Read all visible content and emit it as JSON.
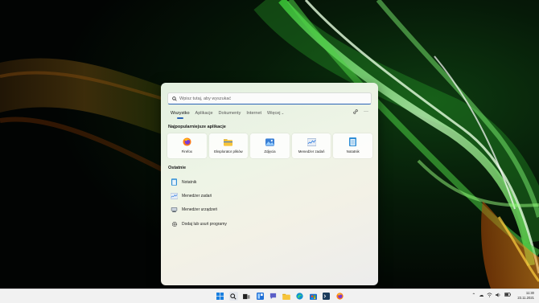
{
  "search": {
    "placeholder": "Wpisz tutaj, aby wyszukać",
    "value": ""
  },
  "tabs": [
    {
      "label": "Wszystko",
      "active": true
    },
    {
      "label": "Aplikacje"
    },
    {
      "label": "Dokumenty"
    },
    {
      "label": "Internet"
    },
    {
      "label": "Więcej",
      "has_dropdown": true
    }
  ],
  "tab_tools": {
    "share_icon": "share-icon",
    "more": "···"
  },
  "top_apps": {
    "title": "Najpopularniejsze aplikacje",
    "items": [
      {
        "label": "Firefox",
        "icon": "firefox-icon"
      },
      {
        "label": "Eksplorator plików",
        "icon": "folder-icon"
      },
      {
        "label": "Zdjęcia",
        "icon": "photos-icon"
      },
      {
        "label": "Menedżer zadań",
        "icon": "task-manager-icon"
      },
      {
        "label": "Notatnik",
        "icon": "notepad-icon"
      }
    ]
  },
  "recent": {
    "title": "Ostatnie",
    "items": [
      {
        "label": "Notatnik",
        "icon": "notepad-icon"
      },
      {
        "label": "Menedżer zadań",
        "icon": "task-manager-icon"
      },
      {
        "label": "Menedżer urządzeń",
        "icon": "device-manager-icon"
      },
      {
        "label": "Dodaj lub usuń programy",
        "icon": "gear-icon"
      }
    ]
  },
  "taskbar": {
    "icons": [
      "start-icon",
      "search-icon",
      "task-view-icon",
      "widgets-icon",
      "chat-icon",
      "file-explorer-icon",
      "edge-icon",
      "store-icon",
      "terminal-icon",
      "firefox-icon"
    ],
    "tray": {
      "time": "11:30",
      "date": "23.11.2021"
    }
  },
  "colors": {
    "accent": "#2a63b6"
  }
}
